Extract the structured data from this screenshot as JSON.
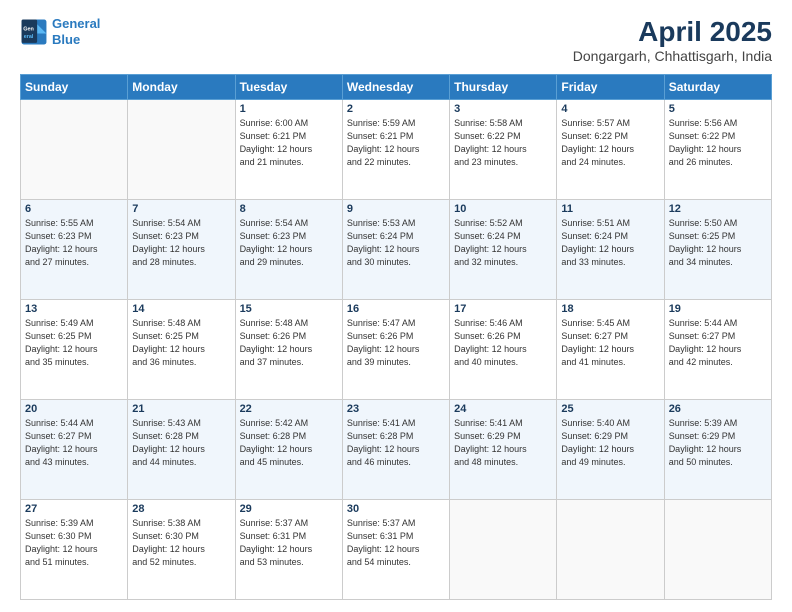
{
  "header": {
    "logo_line1": "General",
    "logo_line2": "Blue",
    "title": "April 2025",
    "subtitle": "Dongargarh, Chhattisgarh, India"
  },
  "weekdays": [
    "Sunday",
    "Monday",
    "Tuesday",
    "Wednesday",
    "Thursday",
    "Friday",
    "Saturday"
  ],
  "weeks": [
    [
      {
        "day": "",
        "info": ""
      },
      {
        "day": "",
        "info": ""
      },
      {
        "day": "1",
        "info": "Sunrise: 6:00 AM\nSunset: 6:21 PM\nDaylight: 12 hours\nand 21 minutes."
      },
      {
        "day": "2",
        "info": "Sunrise: 5:59 AM\nSunset: 6:21 PM\nDaylight: 12 hours\nand 22 minutes."
      },
      {
        "day": "3",
        "info": "Sunrise: 5:58 AM\nSunset: 6:22 PM\nDaylight: 12 hours\nand 23 minutes."
      },
      {
        "day": "4",
        "info": "Sunrise: 5:57 AM\nSunset: 6:22 PM\nDaylight: 12 hours\nand 24 minutes."
      },
      {
        "day": "5",
        "info": "Sunrise: 5:56 AM\nSunset: 6:22 PM\nDaylight: 12 hours\nand 26 minutes."
      }
    ],
    [
      {
        "day": "6",
        "info": "Sunrise: 5:55 AM\nSunset: 6:23 PM\nDaylight: 12 hours\nand 27 minutes."
      },
      {
        "day": "7",
        "info": "Sunrise: 5:54 AM\nSunset: 6:23 PM\nDaylight: 12 hours\nand 28 minutes."
      },
      {
        "day": "8",
        "info": "Sunrise: 5:54 AM\nSunset: 6:23 PM\nDaylight: 12 hours\nand 29 minutes."
      },
      {
        "day": "9",
        "info": "Sunrise: 5:53 AM\nSunset: 6:24 PM\nDaylight: 12 hours\nand 30 minutes."
      },
      {
        "day": "10",
        "info": "Sunrise: 5:52 AM\nSunset: 6:24 PM\nDaylight: 12 hours\nand 32 minutes."
      },
      {
        "day": "11",
        "info": "Sunrise: 5:51 AM\nSunset: 6:24 PM\nDaylight: 12 hours\nand 33 minutes."
      },
      {
        "day": "12",
        "info": "Sunrise: 5:50 AM\nSunset: 6:25 PM\nDaylight: 12 hours\nand 34 minutes."
      }
    ],
    [
      {
        "day": "13",
        "info": "Sunrise: 5:49 AM\nSunset: 6:25 PM\nDaylight: 12 hours\nand 35 minutes."
      },
      {
        "day": "14",
        "info": "Sunrise: 5:48 AM\nSunset: 6:25 PM\nDaylight: 12 hours\nand 36 minutes."
      },
      {
        "day": "15",
        "info": "Sunrise: 5:48 AM\nSunset: 6:26 PM\nDaylight: 12 hours\nand 37 minutes."
      },
      {
        "day": "16",
        "info": "Sunrise: 5:47 AM\nSunset: 6:26 PM\nDaylight: 12 hours\nand 39 minutes."
      },
      {
        "day": "17",
        "info": "Sunrise: 5:46 AM\nSunset: 6:26 PM\nDaylight: 12 hours\nand 40 minutes."
      },
      {
        "day": "18",
        "info": "Sunrise: 5:45 AM\nSunset: 6:27 PM\nDaylight: 12 hours\nand 41 minutes."
      },
      {
        "day": "19",
        "info": "Sunrise: 5:44 AM\nSunset: 6:27 PM\nDaylight: 12 hours\nand 42 minutes."
      }
    ],
    [
      {
        "day": "20",
        "info": "Sunrise: 5:44 AM\nSunset: 6:27 PM\nDaylight: 12 hours\nand 43 minutes."
      },
      {
        "day": "21",
        "info": "Sunrise: 5:43 AM\nSunset: 6:28 PM\nDaylight: 12 hours\nand 44 minutes."
      },
      {
        "day": "22",
        "info": "Sunrise: 5:42 AM\nSunset: 6:28 PM\nDaylight: 12 hours\nand 45 minutes."
      },
      {
        "day": "23",
        "info": "Sunrise: 5:41 AM\nSunset: 6:28 PM\nDaylight: 12 hours\nand 46 minutes."
      },
      {
        "day": "24",
        "info": "Sunrise: 5:41 AM\nSunset: 6:29 PM\nDaylight: 12 hours\nand 48 minutes."
      },
      {
        "day": "25",
        "info": "Sunrise: 5:40 AM\nSunset: 6:29 PM\nDaylight: 12 hours\nand 49 minutes."
      },
      {
        "day": "26",
        "info": "Sunrise: 5:39 AM\nSunset: 6:29 PM\nDaylight: 12 hours\nand 50 minutes."
      }
    ],
    [
      {
        "day": "27",
        "info": "Sunrise: 5:39 AM\nSunset: 6:30 PM\nDaylight: 12 hours\nand 51 minutes."
      },
      {
        "day": "28",
        "info": "Sunrise: 5:38 AM\nSunset: 6:30 PM\nDaylight: 12 hours\nand 52 minutes."
      },
      {
        "day": "29",
        "info": "Sunrise: 5:37 AM\nSunset: 6:31 PM\nDaylight: 12 hours\nand 53 minutes."
      },
      {
        "day": "30",
        "info": "Sunrise: 5:37 AM\nSunset: 6:31 PM\nDaylight: 12 hours\nand 54 minutes."
      },
      {
        "day": "",
        "info": ""
      },
      {
        "day": "",
        "info": ""
      },
      {
        "day": "",
        "info": ""
      }
    ]
  ]
}
